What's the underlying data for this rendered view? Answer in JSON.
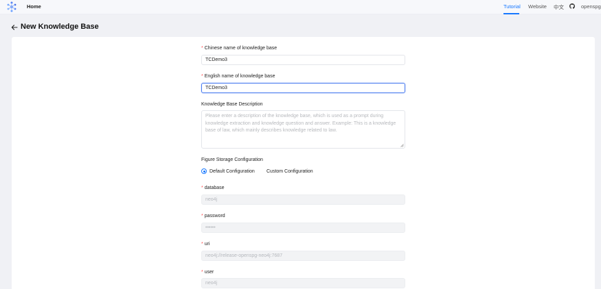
{
  "nav": {
    "home": "Home",
    "tutorial": "Tutorial",
    "website": "Website",
    "language": "中文",
    "user": "openspg"
  },
  "page": {
    "title": "New Knowledge Base"
  },
  "form": {
    "chinese_name": {
      "label": "Chinese name of knowledge base",
      "value": "TCDemo3"
    },
    "english_name": {
      "label": "English name of knowledge base",
      "value": "TCDemo3"
    },
    "description": {
      "label": "Knowledge Base Description",
      "placeholder": "Please enter a description of the knowledge base, which is used as a prompt during knowledge extraction and knowledge question and answer. Example: This is a knowledge base of law, which mainly describes knowledge related to law."
    },
    "figure_storage": {
      "label": "Figure Storage Configuration",
      "options": [
        "Default Configuration",
        "Custom Configuration"
      ],
      "selected": "Default Configuration"
    },
    "database": {
      "label": "database",
      "value": "neo4j"
    },
    "password": {
      "label": "password",
      "value": "••••••"
    },
    "uri": {
      "label": "uri",
      "value": "neo4j://release-openspg-neo4j:7687"
    },
    "user": {
      "label": "user",
      "value": "neo4j"
    }
  },
  "colors": {
    "accent": "#1677ff",
    "required": "#ff4d4f",
    "page_bg": "#f0f1f5"
  }
}
